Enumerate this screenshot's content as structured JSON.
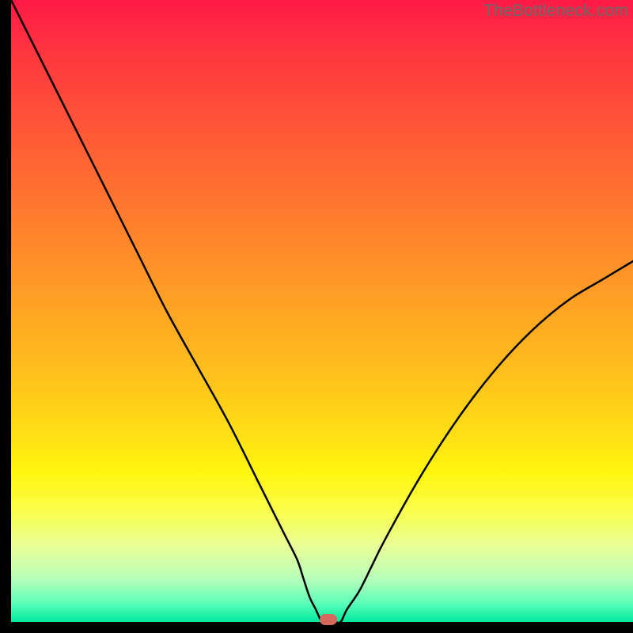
{
  "watermark": "TheBottleneck.com",
  "colors": {
    "background": "#000000",
    "gradient_top": "#ff1a46",
    "gradient_bottom": "#00e8a0",
    "curve": "#000000",
    "marker": "#d46a5e"
  },
  "chart_data": {
    "type": "line",
    "title": "",
    "xlabel": "",
    "ylabel": "",
    "xlim": [
      0,
      100
    ],
    "ylim": [
      0,
      100
    ],
    "x": [
      0,
      5,
      10,
      15,
      20,
      25,
      30,
      35,
      40,
      42,
      44,
      46,
      47,
      48,
      49,
      50,
      51,
      52,
      53,
      54,
      56,
      58,
      60,
      65,
      70,
      75,
      80,
      85,
      90,
      95,
      100
    ],
    "values": [
      100,
      90,
      80,
      70,
      60,
      50,
      41,
      32,
      22,
      18,
      14,
      10,
      7,
      4,
      2,
      0,
      0,
      0,
      0,
      2,
      5,
      9,
      13,
      22,
      30,
      37,
      43,
      48,
      52,
      55,
      58
    ],
    "minimum": {
      "x": 51,
      "y": 0
    },
    "annotations": []
  }
}
